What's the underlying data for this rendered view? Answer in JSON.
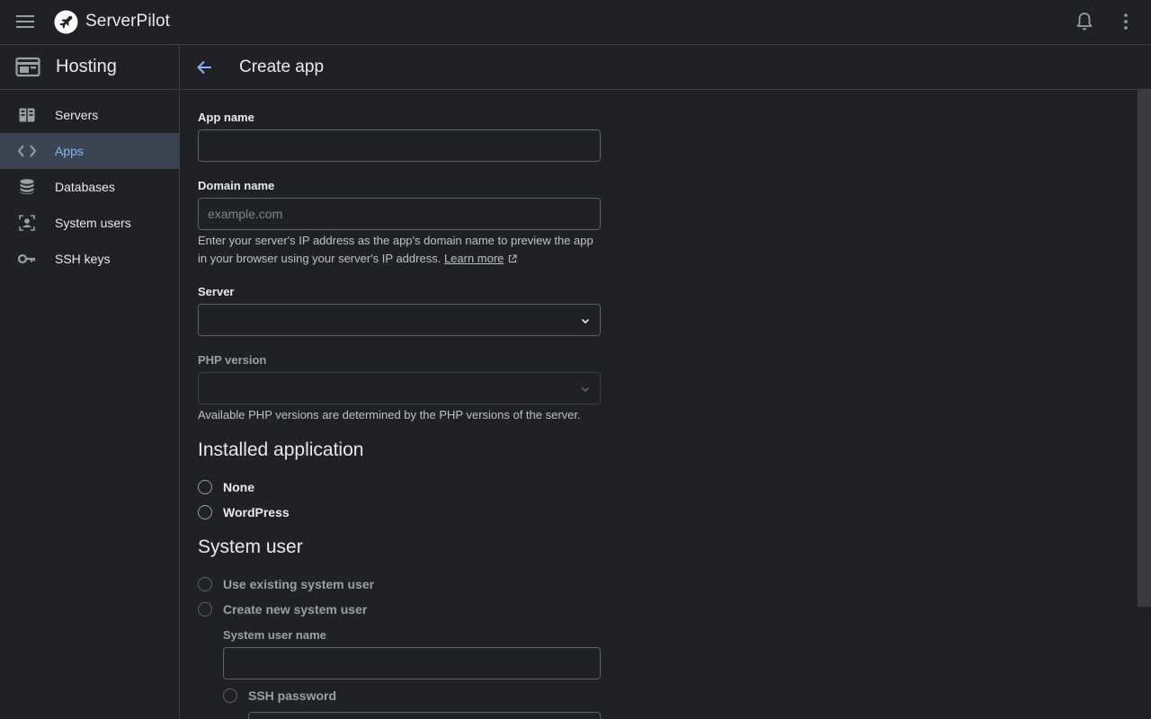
{
  "app": {
    "brand": "ServerPilot"
  },
  "sidebar": {
    "title": "Hosting",
    "items": [
      {
        "label": "Servers",
        "icon": "servers-icon"
      },
      {
        "label": "Apps",
        "icon": "code-icon"
      },
      {
        "label": "Databases",
        "icon": "database-icon"
      },
      {
        "label": "System users",
        "icon": "users-icon"
      },
      {
        "label": "SSH keys",
        "icon": "key-icon"
      }
    ],
    "active": "Apps"
  },
  "header": {
    "title": "Create app"
  },
  "form": {
    "app_name": {
      "label": "App name",
      "value": ""
    },
    "domain_name": {
      "label": "Domain name",
      "placeholder": "example.com",
      "help": "Enter your server's IP address as the app's domain name to preview the app in your browser using your server's IP address.",
      "learn_more": "Learn more"
    },
    "server": {
      "label": "Server",
      "value": ""
    },
    "php_version": {
      "label": "PHP version",
      "value": "",
      "help": "Available PHP versions are determined by the PHP versions of the server."
    },
    "installed_application": {
      "title": "Installed application",
      "options": [
        "None",
        "WordPress"
      ]
    },
    "system_user": {
      "title": "System user",
      "options": [
        "Use existing system user",
        "Create new system user"
      ],
      "name_label": "System user name",
      "ssh_password_label": "SSH password"
    }
  },
  "colors": {
    "background": "#202124",
    "active_nav_bg": "#3b4453",
    "accent": "#8ab4f8",
    "border": "#5f6368"
  }
}
